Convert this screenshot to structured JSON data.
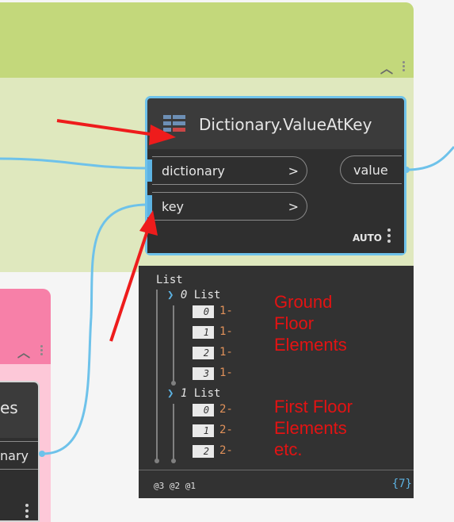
{
  "node": {
    "title": "Dictionary.ValueAtKey",
    "inputs": [
      {
        "label": "dictionary",
        "chevron": ">"
      },
      {
        "label": "key",
        "chevron": ">"
      }
    ],
    "output": {
      "label": "value"
    },
    "lacing": "AUTO"
  },
  "left_node": {
    "title_fragment": "es",
    "output_fragment": "nary"
  },
  "preview": {
    "root": "List",
    "groups": [
      {
        "index": "0",
        "label": "List",
        "items": [
          {
            "index": "0",
            "value": "1-"
          },
          {
            "index": "1",
            "value": "1-"
          },
          {
            "index": "2",
            "value": "1-"
          },
          {
            "index": "3",
            "value": "1-"
          }
        ]
      },
      {
        "index": "1",
        "label": "List",
        "items": [
          {
            "index": "0",
            "value": "2-"
          },
          {
            "index": "1",
            "value": "2-"
          },
          {
            "index": "2",
            "value": "2-"
          }
        ]
      }
    ],
    "levels": "@3 @2 @1",
    "count": "{7}"
  },
  "annotations": {
    "ground": [
      "Ground",
      "Floor",
      "Elements"
    ],
    "first": [
      "First Floor",
      "Elements",
      "etc."
    ]
  },
  "colors": {
    "wire": "#6ec2ea",
    "arrow": "#ee1c1c",
    "green_group_header": "#c3d87b",
    "pink_group_header": "#f780a8"
  }
}
